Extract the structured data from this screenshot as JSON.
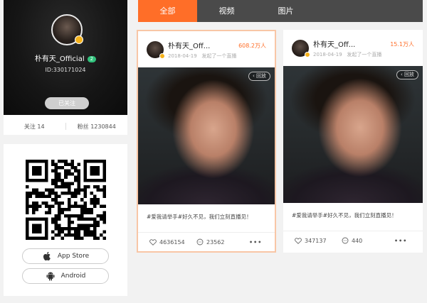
{
  "profile": {
    "name": "朴有天_Official",
    "level": "2",
    "id_text": "ID:330171024",
    "follow_label": "已关注",
    "following": "关注 14",
    "fans": "粉丝 1230844"
  },
  "download": {
    "appstore_label": "App Store",
    "android_label": "Android"
  },
  "tabs": [
    {
      "label": "全部",
      "active": true
    },
    {
      "label": "视频",
      "active": false
    },
    {
      "label": "图片",
      "active": false
    }
  ],
  "cards": [
    {
      "name": "朴有天_Off...",
      "views": "608.2万人",
      "date": "2018-04-19",
      "action": "发起了一个直播",
      "replay": "‹ 回放",
      "desc": "#爱我请举手#好久不见，我们立刻直播见！",
      "likes": "4636154",
      "comments": "23562",
      "more": "•••"
    },
    {
      "name": "朴有天_Off...",
      "views": "15.1万人",
      "date": "2018-04-19",
      "action": "发起了一个直播",
      "replay": "‹ 回放",
      "desc": "#爱我请举手#好久不见，我们立刻直播见！",
      "likes": "347137",
      "comments": "440",
      "more": "•••"
    }
  ],
  "colors": {
    "accent": "#ff6e28",
    "tabbar": "#4a4a4a",
    "level": "#31c27c"
  }
}
